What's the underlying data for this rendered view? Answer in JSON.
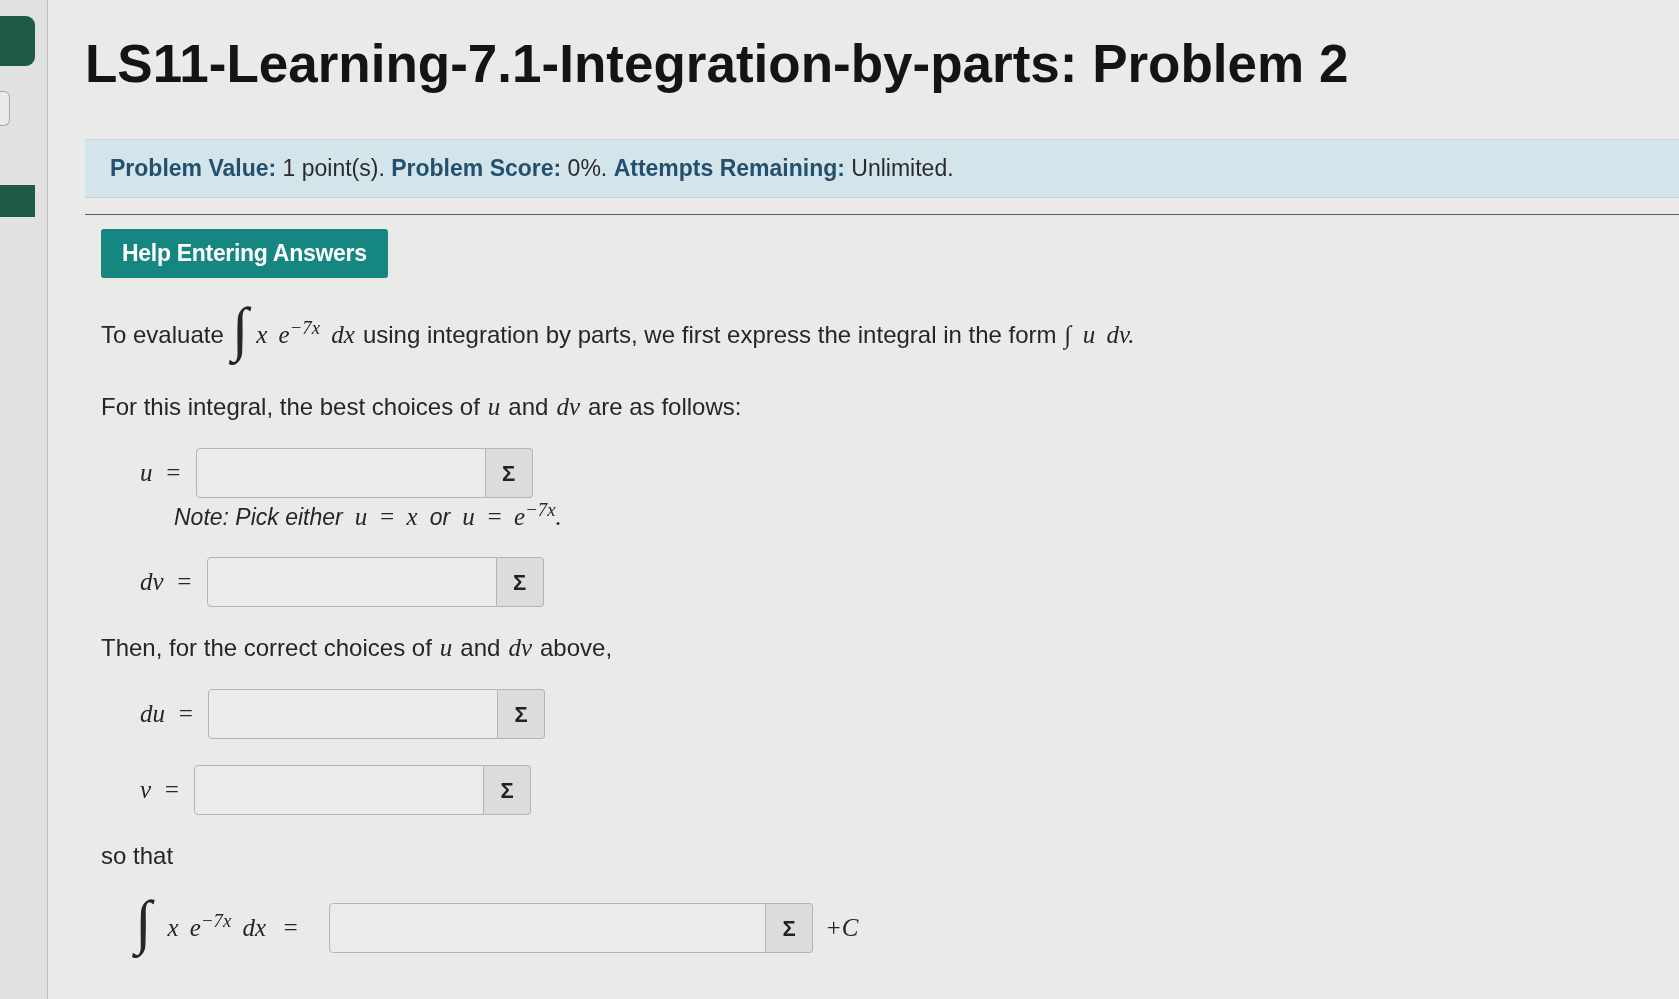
{
  "title": "LS11-Learning-7.1-Integration-by-parts: Problem 2",
  "problem_info": "**Problem Value:** 1 point(s). **Problem Score:** 0%. **Attempts Remaining:** Unlimited.",
  "help_button": "Help Entering Answers",
  "blocks": [
    {
      "kind": "text",
      "parts": [
        {
          "kind": "prose",
          "text": "To evaluate"
        },
        {
          "kind": "integral",
          "text": "∫"
        },
        {
          "kind": "math",
          "text": "x e$^{−7x}$ dx"
        },
        {
          "kind": "prose",
          "text": "using integration by parts, we first express the integral in the form"
        },
        {
          "kind": "math",
          "text": "∫ u dv."
        }
      ]
    },
    {
      "kind": "text",
      "parts": [
        {
          "kind": "prose",
          "text": "For this integral, the best choices of"
        },
        {
          "kind": "math",
          "text": "u"
        },
        {
          "kind": "prose",
          "text": "and"
        },
        {
          "kind": "math",
          "text": "dv"
        },
        {
          "kind": "prose",
          "text": "are as follows:"
        }
      ]
    },
    {
      "kind": "answer",
      "label": "u =",
      "button": "Σ"
    },
    {
      "kind": "note",
      "parts": [
        {
          "kind": "prose",
          "text": "Note: Pick either"
        },
        {
          "kind": "math",
          "text": "u = x"
        },
        {
          "kind": "prose",
          "text": "or"
        },
        {
          "kind": "math",
          "text": "u = e$^{−7x}$."
        }
      ]
    },
    {
      "kind": "answer",
      "label": "dv =",
      "button": "Σ"
    },
    {
      "kind": "text",
      "parts": [
        {
          "kind": "prose",
          "text": "Then, for the correct choices of"
        },
        {
          "kind": "math",
          "text": "u"
        },
        {
          "kind": "prose",
          "text": "and"
        },
        {
          "kind": "math",
          "text": "dv"
        },
        {
          "kind": "prose",
          "text": "above,"
        }
      ]
    },
    {
      "kind": "answer",
      "label": "du =",
      "button": "Σ"
    },
    {
      "kind": "answer",
      "label": "v =",
      "button": "Σ"
    },
    {
      "kind": "text",
      "parts": [
        {
          "kind": "prose",
          "text": "so that"
        }
      ]
    },
    {
      "kind": "final",
      "parts": [
        {
          "kind": "integral",
          "text": "∫"
        },
        {
          "kind": "math",
          "text": "x e$^{−7x}$ dx"
        },
        {
          "kind": "math",
          "text": "="
        }
      ],
      "button": "Σ",
      "suffix": "+C"
    }
  ]
}
